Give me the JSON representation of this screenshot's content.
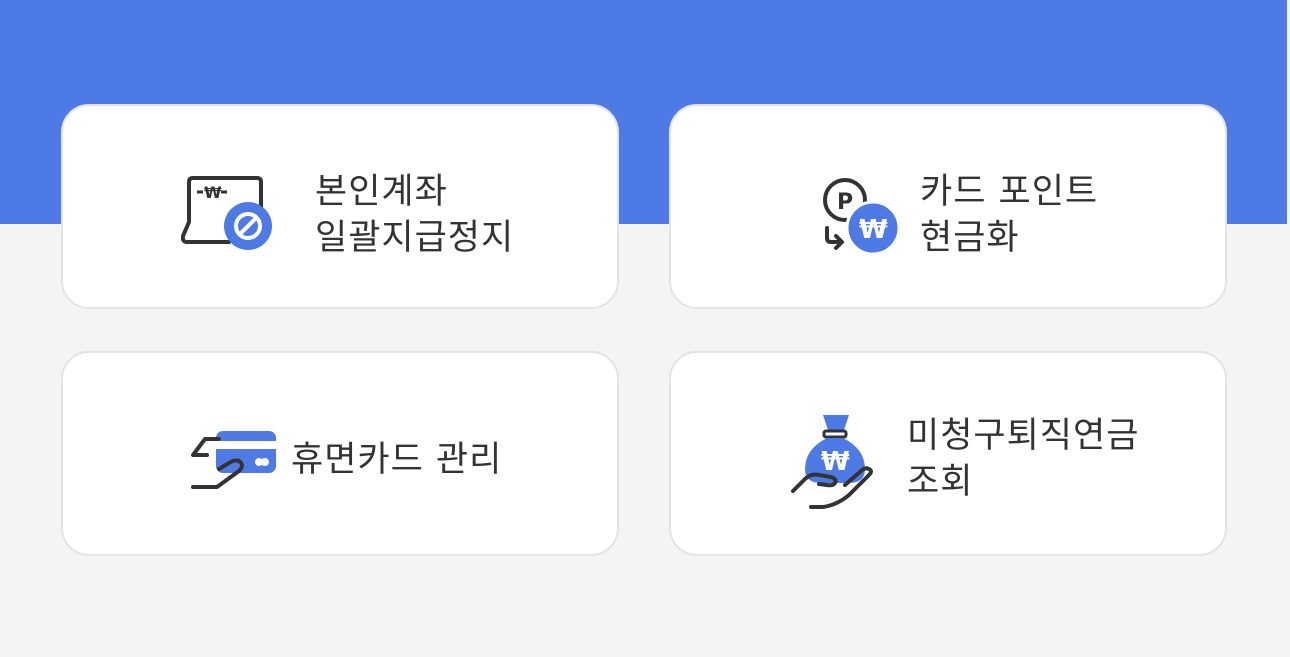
{
  "colors": {
    "banner": "#4e7ae6",
    "background": "#f4f4f4",
    "card": "#ffffff",
    "accent": "#4e7ae6",
    "text": "#333333"
  },
  "menu": {
    "items": [
      {
        "icon": "laptop-won-block-icon",
        "lines": [
          "본인계좌",
          "일괄지급정지"
        ]
      },
      {
        "icon": "point-to-won-icon",
        "lines": [
          "카드 포인트",
          "현금화"
        ]
      },
      {
        "icon": "hand-card-icon",
        "lines": [
          "휴면카드 관리"
        ]
      },
      {
        "icon": "money-bag-hand-icon",
        "lines": [
          "미청구퇴직연금",
          "조회"
        ]
      }
    ]
  }
}
